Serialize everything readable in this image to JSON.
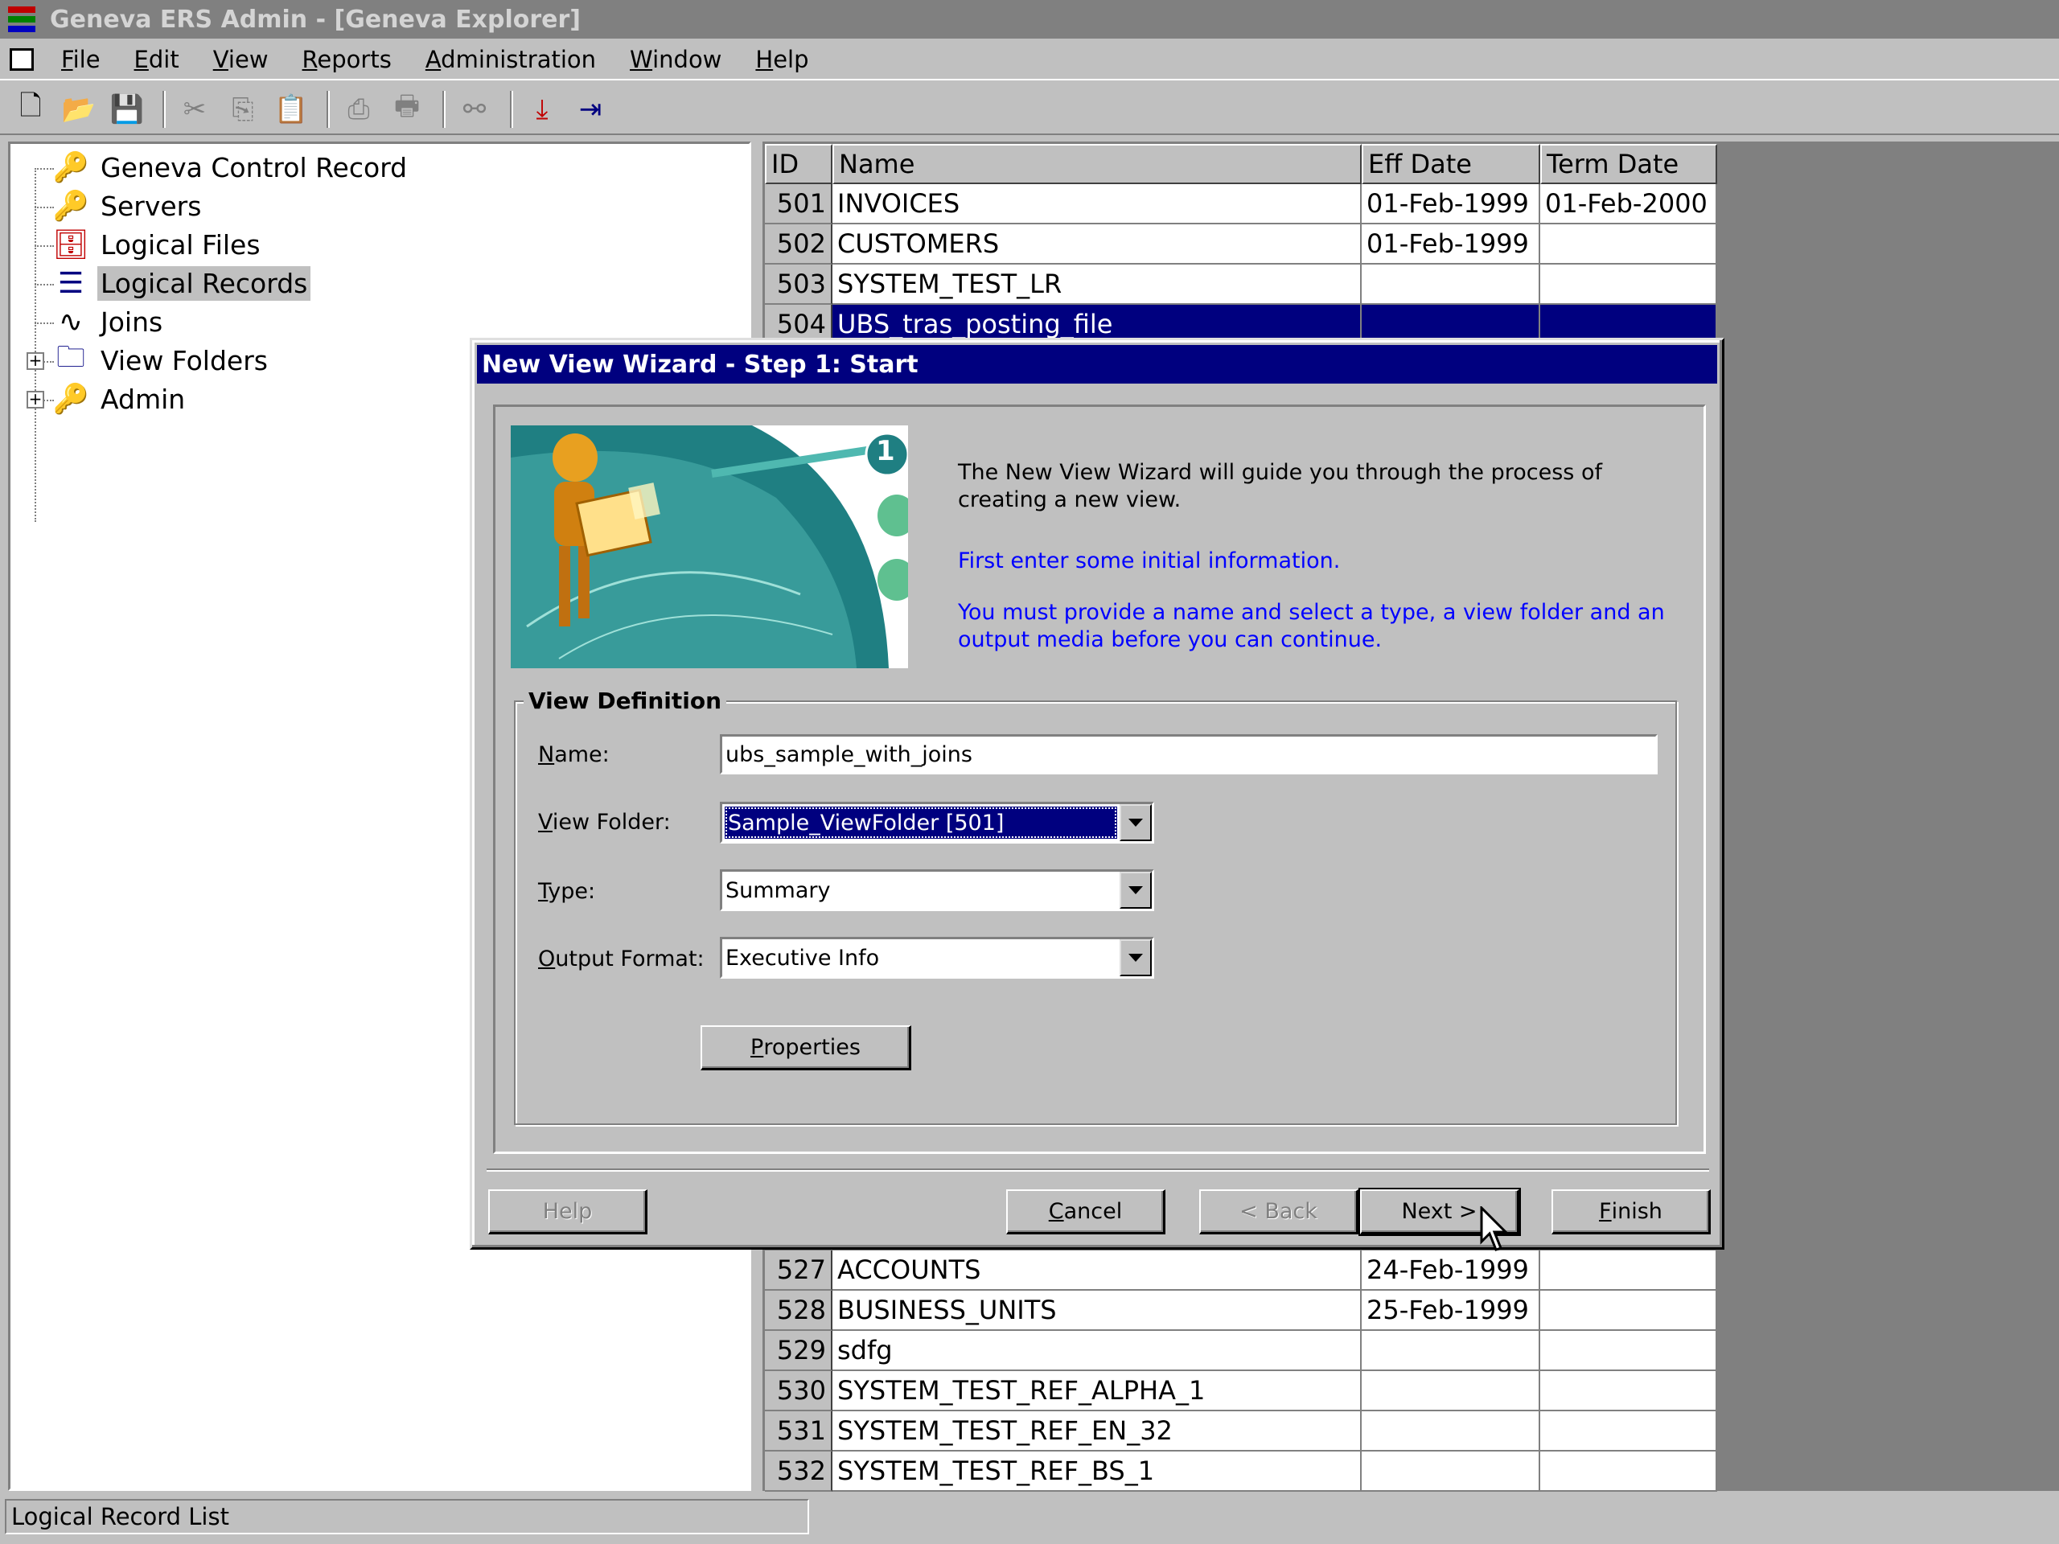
{
  "window": {
    "title": "Geneva ERS Admin - [Geneva Explorer]"
  },
  "menu": {
    "items": [
      {
        "pre": "",
        "mn": "F",
        "post": "ile"
      },
      {
        "pre": "",
        "mn": "E",
        "post": "dit"
      },
      {
        "pre": "",
        "mn": "V",
        "post": "iew"
      },
      {
        "pre": "",
        "mn": "R",
        "post": "eports"
      },
      {
        "pre": "",
        "mn": "A",
        "post": "dministration"
      },
      {
        "pre": "",
        "mn": "W",
        "post": "indow"
      },
      {
        "pre": "",
        "mn": "H",
        "post": "elp"
      }
    ]
  },
  "toolbar": {
    "icons": [
      "new-icon",
      "open-icon",
      "save-icon",
      "cut-icon",
      "copy-icon",
      "paste-icon",
      "print-icon",
      "print-preview-icon",
      "hierarchy-icon",
      "import-icon",
      "export-icon"
    ]
  },
  "tree": {
    "items": [
      {
        "label": "Geneva Control Record",
        "icon": "control-record-icon"
      },
      {
        "label": "Servers",
        "icon": "servers-icon"
      },
      {
        "label": "Logical Files",
        "icon": "logical-files-icon"
      },
      {
        "label": "Logical Records",
        "icon": "logical-records-icon"
      },
      {
        "label": "Joins",
        "icon": "joins-icon"
      },
      {
        "label": "View Folders",
        "icon": "view-folders-icon"
      },
      {
        "label": "Admin",
        "icon": "admin-icon"
      }
    ],
    "selected": "Logical Records"
  },
  "grid": {
    "headers": {
      "id": "ID",
      "name": "Name",
      "eff": "Eff Date",
      "term": "Term Date"
    },
    "rows_top": [
      {
        "id": "501",
        "name": "INVOICES",
        "eff": "01-Feb-1999",
        "term": "01-Feb-2000"
      },
      {
        "id": "502",
        "name": "CUSTOMERS",
        "eff": "01-Feb-1999",
        "term": ""
      },
      {
        "id": "503",
        "name": "SYSTEM_TEST_LR",
        "eff": "",
        "term": ""
      },
      {
        "id": "504",
        "name": "UBS_tras_posting_file",
        "eff": "",
        "term": ""
      }
    ],
    "rows_bottom": [
      {
        "id": "527",
        "name": "ACCOUNTS",
        "eff": "24-Feb-1999",
        "term": ""
      },
      {
        "id": "528",
        "name": "BUSINESS_UNITS",
        "eff": "25-Feb-1999",
        "term": ""
      },
      {
        "id": "529",
        "name": "sdfg",
        "eff": "",
        "term": ""
      },
      {
        "id": "530",
        "name": "SYSTEM_TEST_REF_ALPHA_1",
        "eff": "",
        "term": ""
      },
      {
        "id": "531",
        "name": "SYSTEM_TEST_REF_EN_32",
        "eff": "",
        "term": ""
      },
      {
        "id": "532",
        "name": "SYSTEM_TEST_REF_BS_1",
        "eff": "",
        "term": ""
      }
    ]
  },
  "status": {
    "text": "Logical Record List"
  },
  "dialog": {
    "title": "New View Wizard - Step 1: Start",
    "intro": "The New View Wizard will guide you through the process of creating a new view.",
    "instruction1": "First enter some initial information.",
    "instruction2": "You must provide a name and select a type, a view folder and an output media before you can continue.",
    "image_step_number": "1",
    "group_title": "View Definition",
    "fields": {
      "name": {
        "label_mn": "N",
        "label_rest": "ame:",
        "value": "ubs_sample_with_joins"
      },
      "view_folder": {
        "label_mn": "V",
        "label_rest": "iew Folder:",
        "value": "Sample_ViewFolder [501]"
      },
      "type": {
        "label_mn": "T",
        "label_rest": "ype:",
        "value": "Summary"
      },
      "output_format": {
        "label_mn": "O",
        "label_rest": "utput Format:",
        "value": "Executive Info"
      }
    },
    "buttons": {
      "properties": {
        "mn": "P",
        "rest": "roperties"
      },
      "help": "Help",
      "cancel": {
        "mn": "C",
        "rest": "ancel"
      },
      "back": "< Back",
      "next": "Next >",
      "finish": {
        "mn": "F",
        "rest": "inish"
      }
    }
  },
  "colors": {
    "selection": "#00007f",
    "dialog_title": "#00007f",
    "link_blue": "#0000ff",
    "face": "#c0c0c0"
  }
}
